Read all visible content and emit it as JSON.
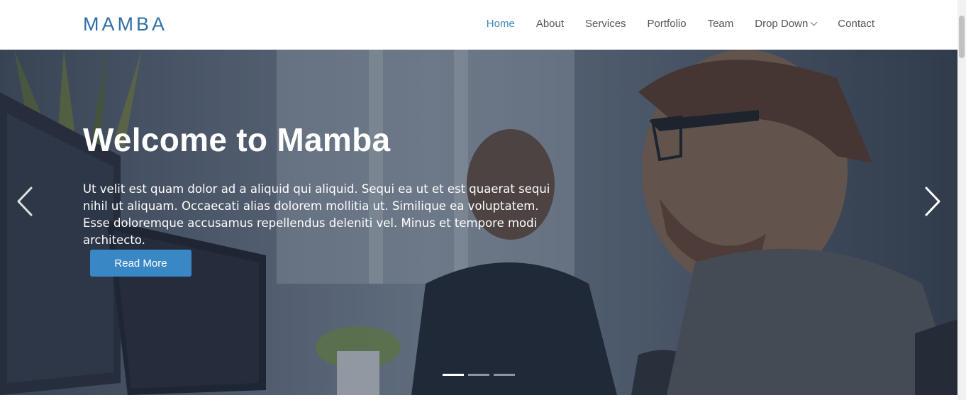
{
  "brand": {
    "logo": "MAMBA"
  },
  "nav": {
    "items": [
      {
        "label": "Home",
        "active": true
      },
      {
        "label": "About",
        "active": false
      },
      {
        "label": "Services",
        "active": false
      },
      {
        "label": "Portfolio",
        "active": false
      },
      {
        "label": "Team",
        "active": false
      },
      {
        "label": "Drop Down",
        "active": false,
        "dropdown": true
      },
      {
        "label": "Contact",
        "active": false
      }
    ]
  },
  "hero": {
    "title": "Welcome to Mamba",
    "text": "Ut velit est quam dolor ad a aliquid qui aliquid. Sequi ea ut et est quaerat sequi nihil ut aliquam. Occaecati alias dolorem mollitia ut. Similique ea voluptatem. Esse doloremque accusamus repellendus deleniti vel. Minus et tempore modi architecto.",
    "button_label": "Read More",
    "slide_count": 3,
    "active_slide": 1
  },
  "colors": {
    "accent": "#3a87c6",
    "logo": "#2f6fa6",
    "nav_active": "#3a87b8",
    "nav_text": "#555555"
  },
  "icons": {
    "prev": "chevron-left-icon",
    "next": "chevron-right-icon",
    "dropdown": "chevron-down-icon"
  }
}
